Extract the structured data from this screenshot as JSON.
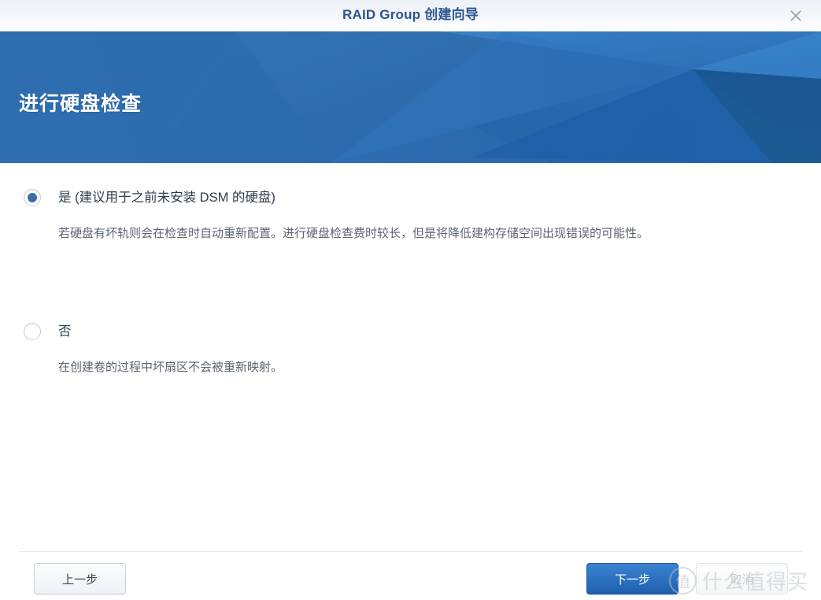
{
  "window": {
    "title": "RAID Group 创建向导",
    "close_icon": "close-icon"
  },
  "banner": {
    "heading": "进行硬盘检查",
    "base_color": "#2d6cb0",
    "accent_light": "#3f87cf",
    "accent_dark": "#17528f"
  },
  "options": [
    {
      "id": "yes",
      "label": "是 (建议用于之前未安装 DSM 的硬盘)",
      "description": "若硬盘有坏轨则会在检查时自动重新配置。进行硬盘检查费时较长，但是将降低建构存储空间出现错误的可能性。",
      "selected": true
    },
    {
      "id": "no",
      "label": "否",
      "description": "在创建卷的过程中坏扇区不会被重新映射。",
      "selected": false
    }
  ],
  "footer": {
    "back_label": "上一步",
    "next_label": "下一步",
    "cancel_label": "取消",
    "primary_color": "#2e74c2"
  },
  "watermark": {
    "badge": "值",
    "text": "什么值得买"
  }
}
